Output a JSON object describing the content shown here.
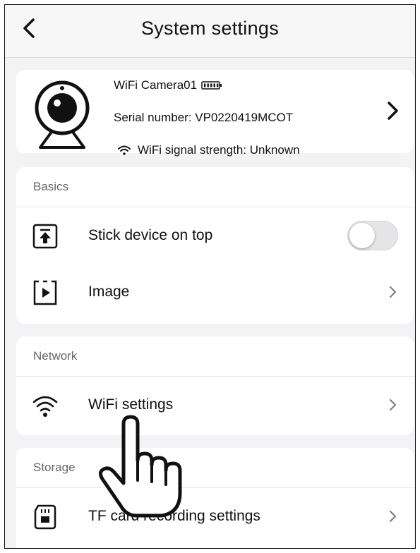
{
  "header": {
    "title": "System settings",
    "back_icon": "chevron-left-icon"
  },
  "device": {
    "name": "WiFi Camera01",
    "serial_label": "Serial number: VP0220419MCOT",
    "signal_label": "WiFi signal strength: Unknown",
    "icons": [
      "camera-icon",
      "battery-icon",
      "wifi-icon",
      "chevron-right-icon"
    ]
  },
  "basics": {
    "header": "Basics",
    "items": [
      {
        "label": "Stick device on top",
        "icon": "pin-top-icon",
        "control": "toggle",
        "toggle_on": false
      },
      {
        "label": "Image",
        "icon": "play-frame-icon",
        "control": "chevron"
      }
    ]
  },
  "network": {
    "header": "Network",
    "items": [
      {
        "label": "WiFi settings",
        "icon": "wifi-icon",
        "control": "chevron"
      }
    ]
  },
  "storage": {
    "header": "Storage",
    "items": [
      {
        "label": "TF card recording settings",
        "icon": "sd-card-icon",
        "control": "chevron"
      }
    ]
  },
  "overlay": {
    "icon": "pointing-hand-icon"
  },
  "colors": {
    "background": "#f3f3f5",
    "card": "#ffffff",
    "section_label": "#666666",
    "toggle_off": "#e5e5e7"
  }
}
